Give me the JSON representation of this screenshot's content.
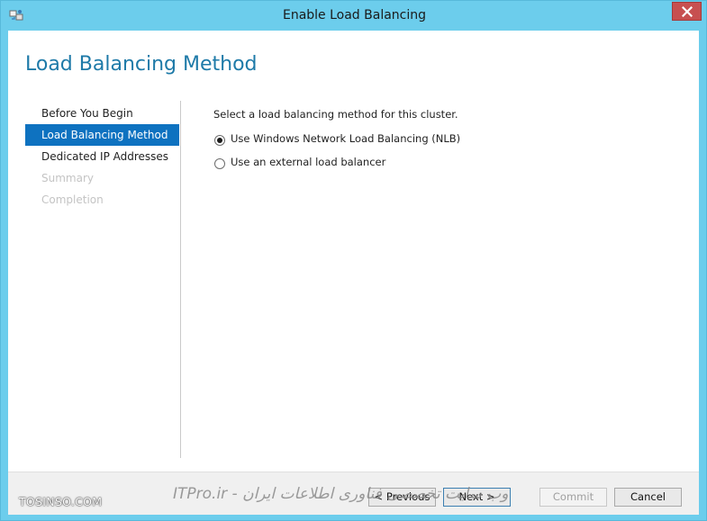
{
  "window": {
    "title": "Enable Load Balancing",
    "icon": "cluster-wizard-icon",
    "close_icon": "close-icon"
  },
  "page": {
    "title": "Load Balancing Method"
  },
  "nav": {
    "items": [
      {
        "label": "Before You Begin",
        "state": "normal"
      },
      {
        "label": "Load Balancing Method",
        "state": "active"
      },
      {
        "label": "Dedicated IP Addresses",
        "state": "normal"
      },
      {
        "label": "Summary",
        "state": "disabled"
      },
      {
        "label": "Completion",
        "state": "disabled"
      }
    ]
  },
  "content": {
    "prompt": "Select a load balancing method for this cluster.",
    "options": [
      {
        "label": "Use Windows Network Load Balancing (NLB)",
        "checked": true
      },
      {
        "label": "Use an external load balancer",
        "checked": false
      }
    ]
  },
  "footer": {
    "previous_label": "< Previous",
    "next_label": "Next >",
    "commit_label": "Commit",
    "cancel_label": "Cancel"
  },
  "watermark": {
    "left": "TOSINSO.COM",
    "right": "وب سایت تخصصی فناوری اطلاعات ایران - ITPro.ir"
  },
  "colors": {
    "titlebar": "#6ccdec",
    "accent": "#0e72c0",
    "page_title": "#1e7aa8",
    "close_button": "#c75050"
  }
}
